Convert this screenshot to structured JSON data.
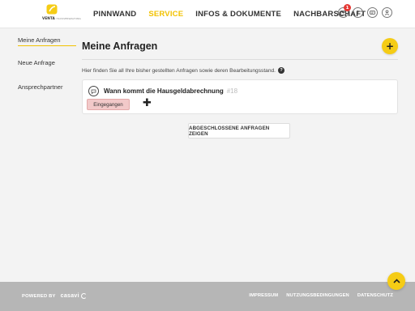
{
  "header": {
    "logo": {
      "name": "VENTA",
      "tagline": "HAUSVERWALTUNG"
    },
    "nav": [
      {
        "label": "PINNWAND",
        "active": false
      },
      {
        "label": "SERVICE",
        "active": true
      },
      {
        "label": "INFOS & DOKUMENTE",
        "active": false
      },
      {
        "label": "NACHBARSCHAFT",
        "active": false
      }
    ],
    "icons": {
      "messages": {
        "icon": "mail-icon",
        "badge": "1"
      },
      "help": {
        "icon": "help-icon",
        "glyph": "?"
      },
      "chat": {
        "icon": "chat-icon"
      },
      "profile": {
        "icon": "user-icon"
      }
    }
  },
  "sidebar": {
    "items": [
      {
        "label": "Meine Anfragen",
        "active": true
      },
      {
        "label": "Neue Anfrage",
        "active": false
      },
      {
        "label": "Ansprechpartner",
        "active": false
      }
    ]
  },
  "main": {
    "title": "Meine Anfragen",
    "add_button": "+",
    "intro": "Hier finden Sie all Ihre bisher gestellten Anfragen sowie deren Bearbeitungsstand.",
    "requests": [
      {
        "title": "Wann kommt die Hausgeldabrechnung",
        "number": "#18",
        "status": "Eingegangen"
      }
    ],
    "closed_button": "ABGESCHLOSSENE ANFRAGEN ZEIGEN"
  },
  "footer": {
    "powered_by": "POWERED BY",
    "brand": "casavi",
    "links": [
      "IMPRESSUM",
      "NUTZUNGSBEDINGUNGEN",
      "DATENSCHUTZ"
    ]
  },
  "colors": {
    "accent": "#f5cc15",
    "active_nav": "#f2c200",
    "status_bg": "#f2c9c9",
    "footer_bg": "#b6b6b6",
    "page_bg": "#f3f3f3"
  }
}
